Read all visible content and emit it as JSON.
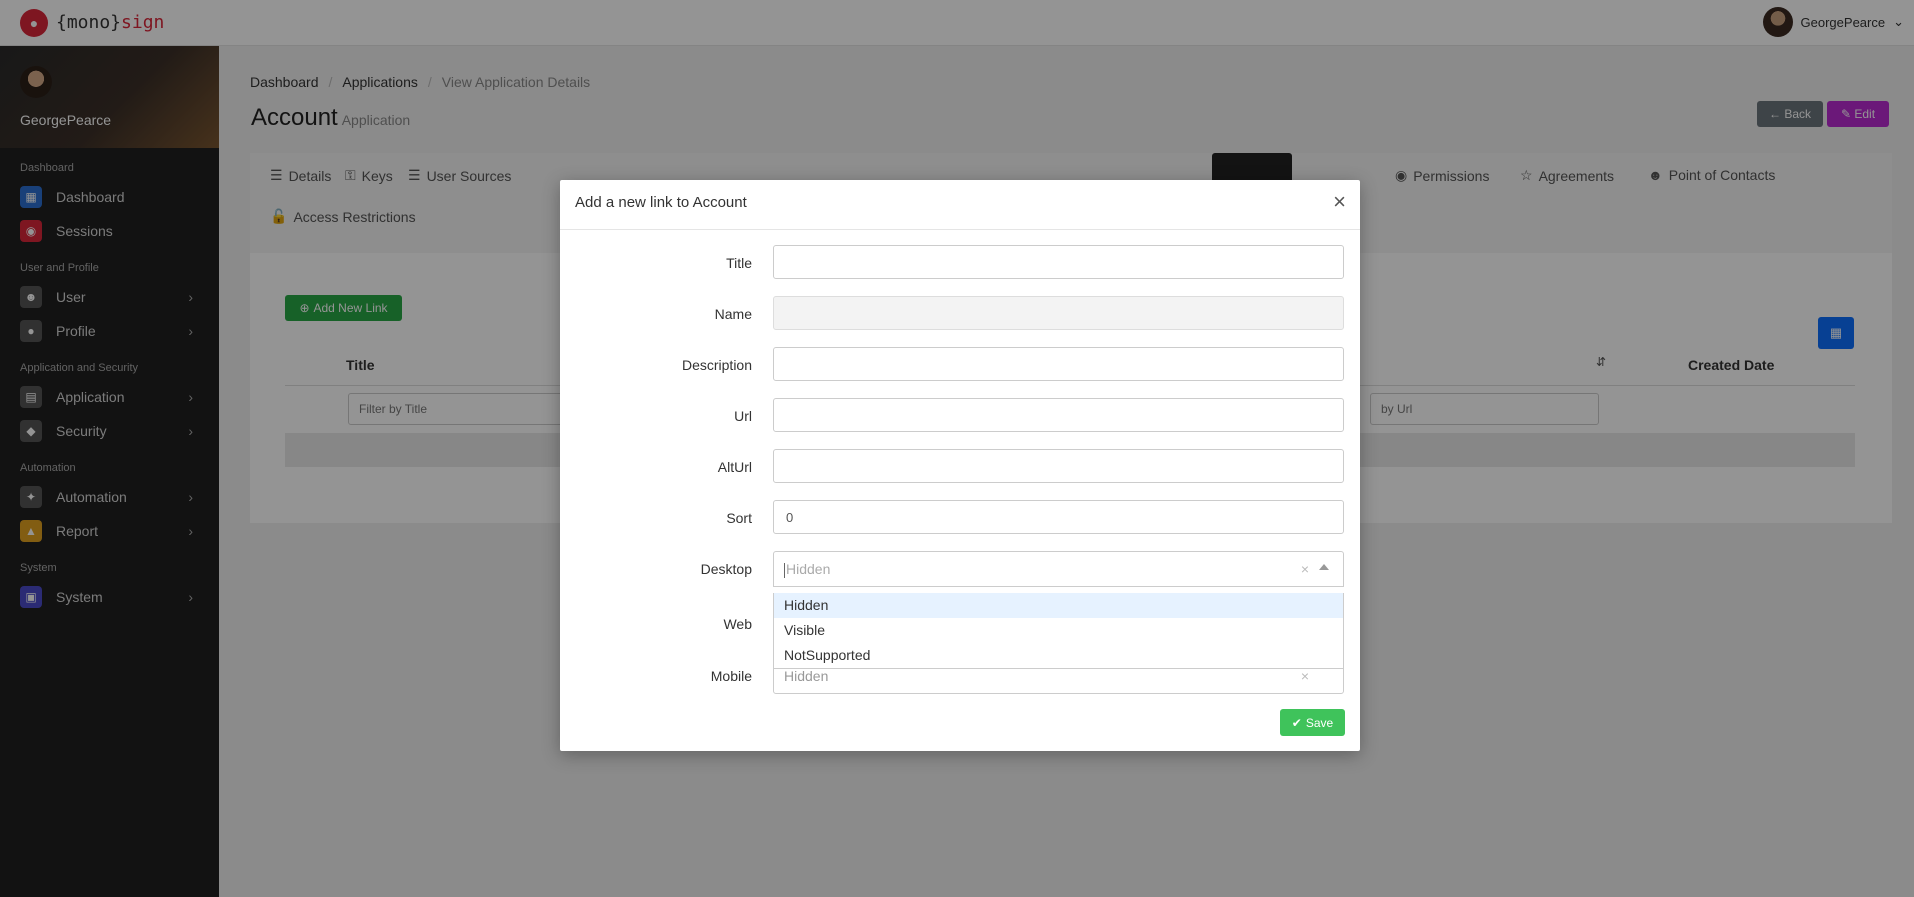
{
  "brand": {
    "logo_prefix": "{mono}",
    "logo_suffix": "sign",
    "accent_color": "#d9263a"
  },
  "topbar": {
    "username": "GeorgePearce"
  },
  "sidebar": {
    "username": "GeorgePearce",
    "sections": [
      {
        "label": "Dashboard",
        "items": [
          {
            "label": "Dashboard",
            "icon": "chart-icon",
            "color": "#2c6fd1",
            "chevron": false
          },
          {
            "label": "Sessions",
            "icon": "record-icon",
            "color": "#d9263a",
            "chevron": false
          }
        ]
      },
      {
        "label": "User and Profile",
        "items": [
          {
            "label": "User",
            "icon": "users-icon",
            "color": "#555",
            "chevron": true
          },
          {
            "label": "Profile",
            "icon": "user-icon",
            "color": "#555",
            "chevron": true
          }
        ]
      },
      {
        "label": "Application and Security",
        "items": [
          {
            "label": "Application",
            "icon": "app-icon",
            "color": "#555",
            "chevron": true
          },
          {
            "label": "Security",
            "icon": "lock-icon",
            "color": "#555",
            "chevron": true
          }
        ]
      },
      {
        "label": "Automation",
        "items": [
          {
            "label": "Automation",
            "icon": "wand-icon",
            "color": "#555",
            "chevron": true
          },
          {
            "label": "Report",
            "icon": "chart-area-icon",
            "color": "#e0a020",
            "chevron": true
          }
        ]
      },
      {
        "label": "System",
        "items": [
          {
            "label": "System",
            "icon": "monitor-icon",
            "color": "#4b4bc8",
            "chevron": true
          }
        ]
      }
    ]
  },
  "breadcrumb": [
    "Dashboard",
    "Applications",
    "View Application Details"
  ],
  "page": {
    "title": "Account",
    "subtitle": "Application",
    "back_label": "Back",
    "edit_label": "Edit"
  },
  "tabs": [
    {
      "label": "Details",
      "icon": "list-icon"
    },
    {
      "label": "Keys",
      "icon": "key-icon"
    },
    {
      "label": "User Sources",
      "icon": "list-icon"
    },
    {
      "label": "Permissions",
      "icon": "eye-icon"
    },
    {
      "label": "Agreements",
      "icon": "handshake-icon"
    },
    {
      "label": "Point of Contacts",
      "icon": "users-icon"
    },
    {
      "label": "Access Restrictions",
      "icon": "unlock-icon"
    }
  ],
  "content": {
    "add_button": "Add New Link",
    "columns": {
      "title": "Title",
      "created": "Created Date"
    },
    "filters": {
      "title_placeholder": "Filter by Title",
      "url_placeholder": "by Url"
    }
  },
  "modal": {
    "title": "Add a new link to Account",
    "fields": {
      "title": {
        "label": "Title",
        "value": ""
      },
      "name": {
        "label": "Name",
        "value": ""
      },
      "description": {
        "label": "Description",
        "value": ""
      },
      "url": {
        "label": "Url",
        "value": ""
      },
      "alturl": {
        "label": "AltUrl",
        "value": ""
      },
      "sort": {
        "label": "Sort",
        "value": "0"
      },
      "desktop": {
        "label": "Desktop",
        "placeholder": "Hidden"
      },
      "web": {
        "label": "Web"
      },
      "mobile": {
        "label": "Mobile",
        "value": "Hidden"
      }
    },
    "dropdown_options": [
      "Hidden",
      "Visible",
      "NotSupported"
    ],
    "dropdown_highlighted": "Hidden",
    "save_label": "Save"
  }
}
